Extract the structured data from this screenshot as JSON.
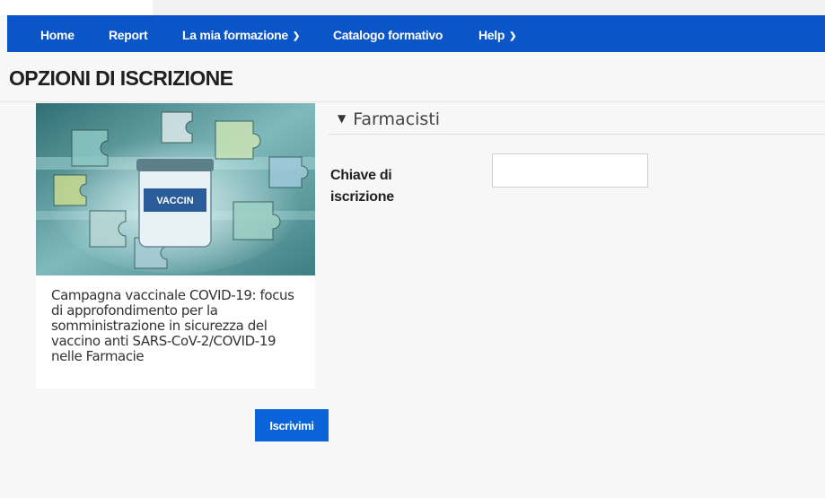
{
  "nav": {
    "items": [
      {
        "label": "Home",
        "dropdown": false
      },
      {
        "label": "Report",
        "dropdown": false
      },
      {
        "label": "La mia formazione",
        "dropdown": true
      },
      {
        "label": "Catalogo formativo",
        "dropdown": false
      },
      {
        "label": "Help",
        "dropdown": true
      }
    ],
    "color": "#0a55c8"
  },
  "page": {
    "title": "OPZIONI DI ISCRIZIONE"
  },
  "course": {
    "description": "Campagna vaccinale COVID-19: focus di approfondimento per la somministrazione in sicurezza del vaccino anti SARS-CoV-2/COVID-19 nelle Farmacie",
    "image_label": "VACCIN"
  },
  "enrol": {
    "section_title": "Farmacisti",
    "key_label": "Chiave di iscrizione",
    "key_value": "",
    "button_label": "Iscrivimi"
  },
  "icons": {
    "dropdown": "chevron-down-icon",
    "section_toggle": "caret-down-icon"
  }
}
